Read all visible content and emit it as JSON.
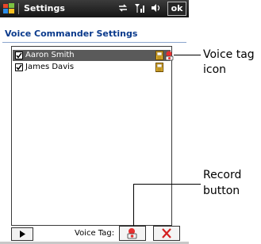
{
  "titlebar": {
    "app_title": "Settings",
    "ok_label": "ok"
  },
  "header": {
    "title": "Voice Commander Settings"
  },
  "contacts": [
    {
      "name": "Aaron Smith",
      "checked": true,
      "selected": true,
      "has_voice_tag": true
    },
    {
      "name": "James Davis",
      "checked": true,
      "selected": false,
      "has_voice_tag": false
    }
  ],
  "controls": {
    "voice_tag_label": "Voice Tag:"
  },
  "callouts": {
    "voice_tag_icon_line1": "Voice tag",
    "voice_tag_icon_line2": "icon",
    "record_button_line1": "Record",
    "record_button_line2": "button"
  }
}
